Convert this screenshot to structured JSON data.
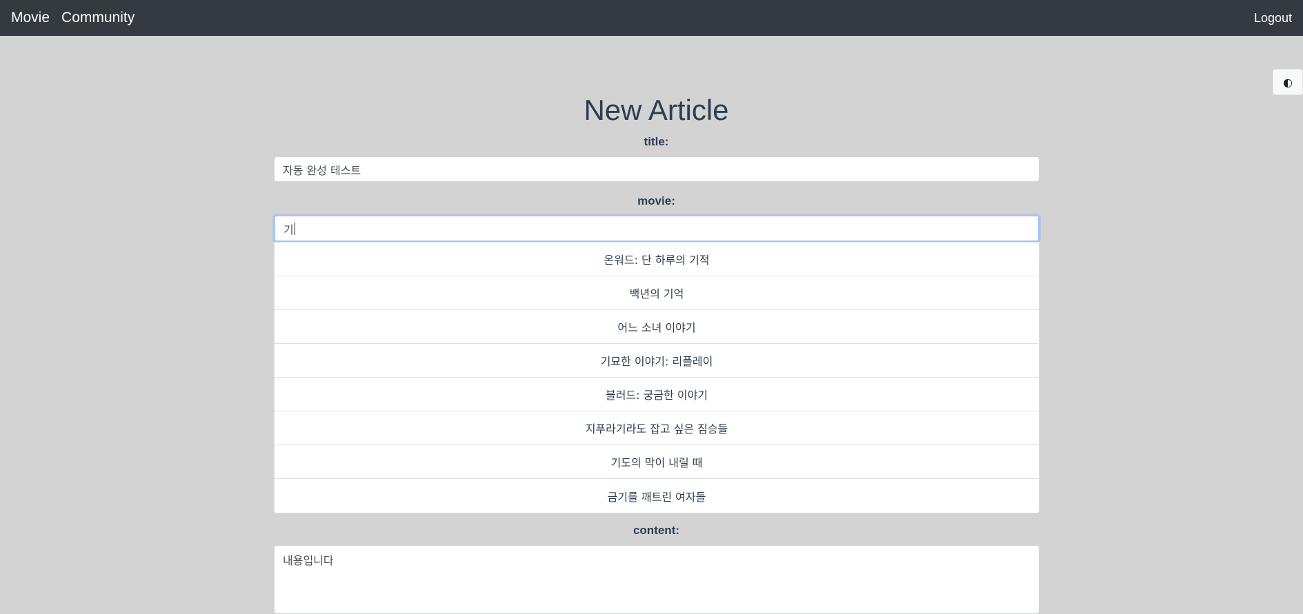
{
  "nav": {
    "links": [
      {
        "label": "Movie"
      },
      {
        "label": "Community"
      }
    ],
    "logout": "Logout"
  },
  "theme_toggle": {
    "icon": "◐",
    "icon_name": "contrast-icon"
  },
  "page": {
    "title": "New Article"
  },
  "form": {
    "title_label": "title:",
    "title_value": "자동 완성 테스트",
    "movie_label": "movie:",
    "movie_value": "기",
    "movie_suggestions": [
      "온워드: 단 하루의 기적",
      "백년의 기억",
      "어느 소녀 이야기",
      "기묘한 이야기: 리플레이",
      "블러드: 궁금한 이야기",
      "지푸라기라도 잡고 싶은 짐승들",
      "기도의 막이 내릴 때",
      "금기를 깨트린 여자들"
    ],
    "content_label": "content:",
    "content_value": "내용입니다"
  }
}
